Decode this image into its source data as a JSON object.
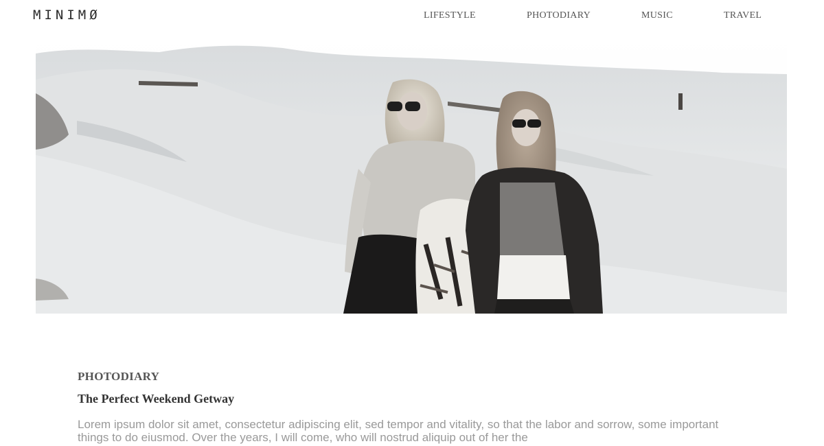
{
  "site": {
    "logo": "MINIMØ"
  },
  "nav": {
    "items": [
      {
        "label": "LIFESTYLE"
      },
      {
        "label": "PHOTODIARY"
      },
      {
        "label": "MUSIC"
      },
      {
        "label": "TRAVEL"
      }
    ]
  },
  "hero": {
    "image": "hero-photo-two-women-on-sand-dunes"
  },
  "article": {
    "category": "PHOTODIARY",
    "title": "The Perfect Weekend Getway",
    "body": "Lorem ipsum dolor sit amet, consectetur adipiscing elit, sed tempor and vitality, so that the labor and sorrow, some important things to do eiusmod. Over the years, I will come, who will nostrud aliquip out of her the"
  }
}
